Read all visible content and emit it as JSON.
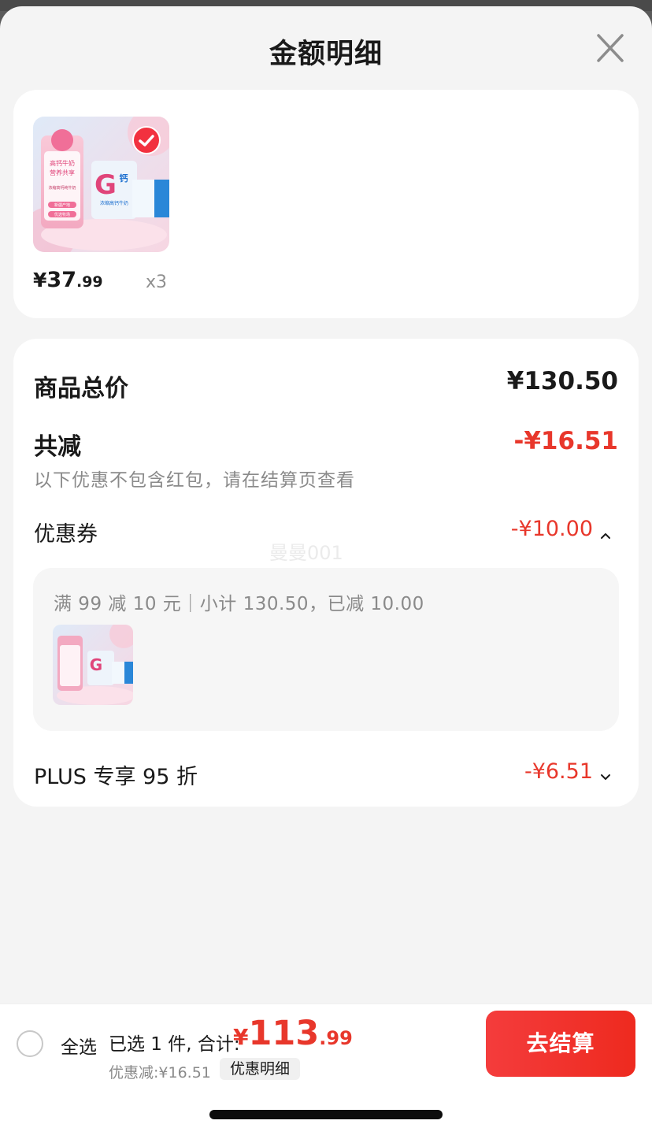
{
  "sheet": {
    "title": "金额明细"
  },
  "product": {
    "price_currency": "¥",
    "price_int": "37",
    "price_dec": ".99",
    "quantity": "x3",
    "image_texts": [
      "高钙牛奶",
      "营养共享",
      "浓缩高钙纯牛奶",
      "新疆产地",
      "优选牧场",
      "浓缩高钙牛奶",
      "钙"
    ]
  },
  "summary": {
    "total_label": "商品总价",
    "total_value": "¥130.50",
    "reduced_label": "共减",
    "reduced_value": "-¥16.51",
    "note": "以下优惠不包含红包，请在结算页查看",
    "watermark": "曼曼001"
  },
  "coupon": {
    "label": "优惠券",
    "value": "-¥10.00",
    "description": "满 99 减 10 元｜小计 130.50，已减 10.00"
  },
  "plus": {
    "label": "PLUS 专享 95 折",
    "value": "-¥6.51"
  },
  "bottom": {
    "select_all": "全选",
    "selected_info": "已选 1 件, 合计:",
    "total_currency": "¥",
    "total_int": "113",
    "total_dec": ".99",
    "discount": "优惠减:¥16.51",
    "detail_button": "优惠明细",
    "checkout_button": "去结算"
  },
  "colors": {
    "accent": "#e8372b",
    "background": "#f4f4f4"
  },
  "icons": [
    "close-icon",
    "check-icon",
    "chevron-up-icon",
    "chevron-down-icon",
    "radio-icon"
  ]
}
